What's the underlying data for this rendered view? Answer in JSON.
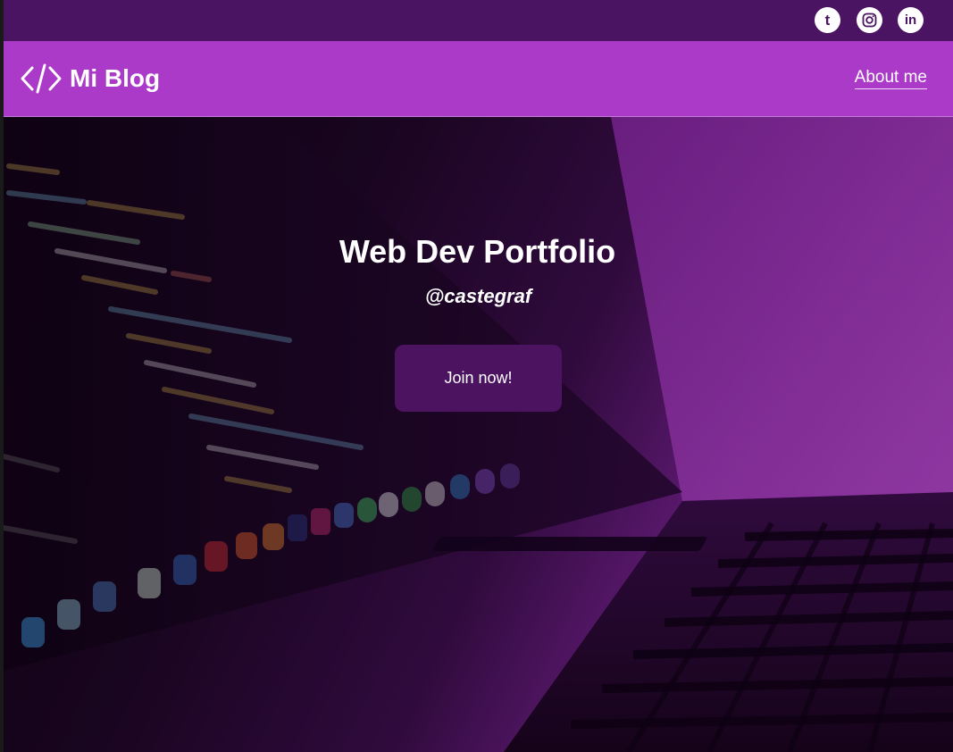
{
  "topbar": {
    "social_links": [
      {
        "name": "tumblr",
        "glyph": "t",
        "icon": "tumblr-icon"
      },
      {
        "name": "instagram",
        "glyph": "",
        "icon": "instagram-icon"
      },
      {
        "name": "linkedin",
        "glyph": "in",
        "icon": "linkedin-icon"
      }
    ]
  },
  "navbar": {
    "brand_icon": "code-icon",
    "brand_title": "Mi Blog",
    "links": [
      {
        "label": "About me"
      }
    ]
  },
  "hero": {
    "title": "Web Dev Portfolio",
    "handle": "@castegraf",
    "cta_label": "Join now!"
  },
  "colors": {
    "topbar_bg": "#4a1462",
    "navbar_bg": "#aa3ac7",
    "button_bg": "#4c1460",
    "text": "#ffffff"
  }
}
